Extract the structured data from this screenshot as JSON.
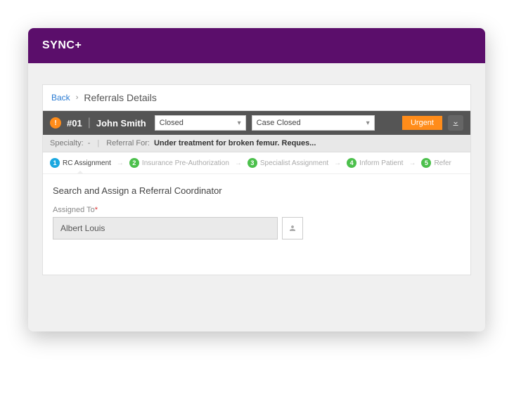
{
  "brand": "SYNC+",
  "breadcrumb": {
    "back": "Back",
    "title": "Referrals Details"
  },
  "header": {
    "badge": "!",
    "case_id": "#01",
    "patient": "John Smith",
    "status1": "Closed",
    "status2": "Case Closed",
    "urgent_label": "Urgent"
  },
  "subheader": {
    "specialty_label": "Specialty:",
    "specialty_value": "-",
    "referral_for_label": "Referral For:",
    "referral_for_value": "Under treatment for broken femur. Reques..."
  },
  "steps": [
    {
      "num": "1",
      "label": "RC Assignment",
      "active": true
    },
    {
      "num": "2",
      "label": "Insurance Pre-Authorization",
      "active": false
    },
    {
      "num": "3",
      "label": "Specialist Assignment",
      "active": false
    },
    {
      "num": "4",
      "label": "Inform Patient",
      "active": false
    },
    {
      "num": "5",
      "label": "Refer",
      "active": false
    }
  ],
  "section": {
    "title": "Search and Assign a Referral Coordinator",
    "assigned_label": "Assigned To",
    "assigned_value": "Albert Louis"
  }
}
